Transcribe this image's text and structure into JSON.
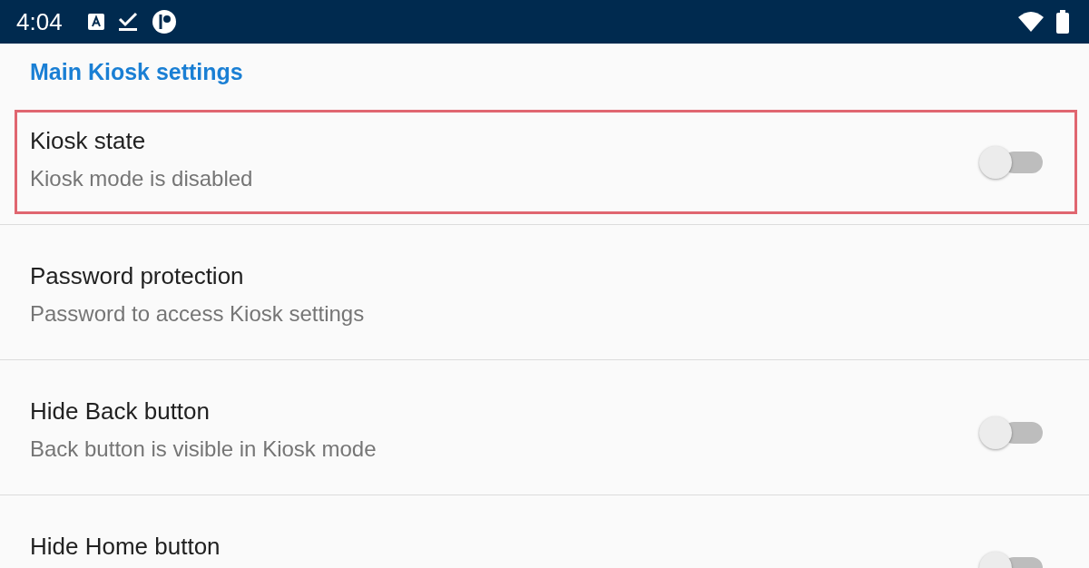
{
  "status_bar": {
    "time": "4:04"
  },
  "section_header": "Main Kiosk settings",
  "settings": [
    {
      "kind": "switch",
      "title": "Kiosk state",
      "summary": "Kiosk mode is disabled",
      "on": false,
      "highlighted": true
    },
    {
      "kind": "plain",
      "title": "Password protection",
      "summary": "Password to access Kiosk settings",
      "highlighted": false
    },
    {
      "kind": "switch",
      "title": "Hide Back button",
      "summary": "Back button is visible in Kiosk mode",
      "on": false,
      "highlighted": false
    },
    {
      "kind": "switch",
      "title": "Hide Home button",
      "on": false,
      "highlighted": false
    }
  ]
}
